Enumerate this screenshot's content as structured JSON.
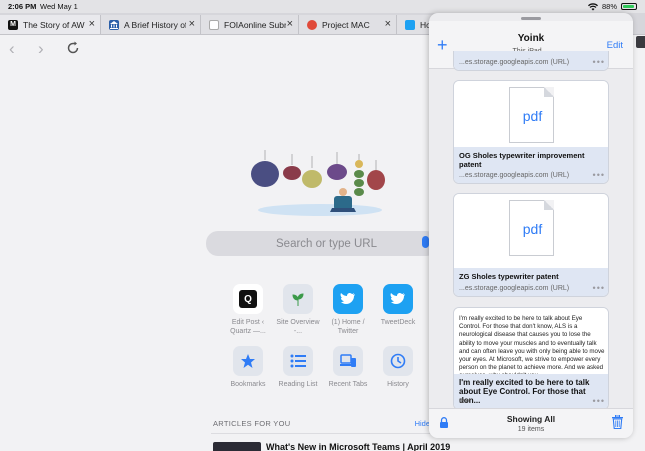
{
  "status": {
    "time": "2:06 PM",
    "date": "Wed May 1",
    "battery": "88%",
    "battery_level": 0.88
  },
  "tabs": [
    {
      "label": "The Story of AWS",
      "fav": "M",
      "fav_color": "#111111"
    },
    {
      "label": "A Brief History of",
      "fav": "🏛",
      "fav_color": "#2b5fa8"
    },
    {
      "label": "FOIAonline Subm",
      "fav": "",
      "fav_color": "#c9c9ce"
    },
    {
      "label": "Project MAC",
      "fav": "",
      "fav_color": "#e04a3a"
    },
    {
      "label": "Hom",
      "fav": "",
      "fav_color": "#1da1f2"
    }
  ],
  "search": {
    "placeholder": "Search or type URL"
  },
  "favorites": [
    {
      "label": "Edit Post ‹ Quartz —...",
      "icon": "quartz-icon",
      "color": "#111111"
    },
    {
      "label": "Site Overview -...",
      "icon": "plant-icon",
      "color": "#3c9a4a"
    },
    {
      "label": "(1) Home / Twitter",
      "icon": "twitter-icon",
      "color": "#1da1f2"
    },
    {
      "label": "TweetDeck",
      "icon": "twitter-icon",
      "color": "#1da1f2"
    },
    {
      "label": "Bookmarks",
      "icon": "star-icon",
      "color": "#2f7cf6"
    },
    {
      "label": "Reading List",
      "icon": "list-icon",
      "color": "#2f7cf6"
    },
    {
      "label": "Recent Tabs",
      "icon": "devices-icon",
      "color": "#2f7cf6"
    },
    {
      "label": "History",
      "icon": "clock-icon",
      "color": "#2f7cf6"
    }
  ],
  "articles": {
    "heading": "ARTICLES FOR YOU",
    "hide": "Hide",
    "first_title": "What's New in Microsoft Teams | April 2019"
  },
  "yoink": {
    "title": "Yoink",
    "subtitle": "This iPad ⌄",
    "edit": "Edit",
    "items": [
      {
        "title": "",
        "source": "...es.storage.googleapis.com (URL)"
      },
      {
        "title": "OG Sholes typewriter improvement patent",
        "source": "...es.storage.googleapis.com (URL)",
        "preview": "pdf"
      },
      {
        "title": "ZG Sholes typewriter patent",
        "source": "...es.storage.googleapis.com (URL)",
        "preview": "pdf"
      },
      {
        "title": "I'm really excited to be here to talk about Eye Control. For those that don...",
        "source": "text",
        "text": "I'm really excited to be here to talk about Eye Control. For those that don't know, ALS is a neurological disease that causes you to lose the ability to move your muscles and to eventually talk and can often leave you with only being able to move your eyes. At Microsoft, we strive to empower every person on the planet to achieve more. And we asked ourselves, why shouldn't you"
      }
    ],
    "footer_title": "Showing All",
    "footer_count": "19 items"
  }
}
